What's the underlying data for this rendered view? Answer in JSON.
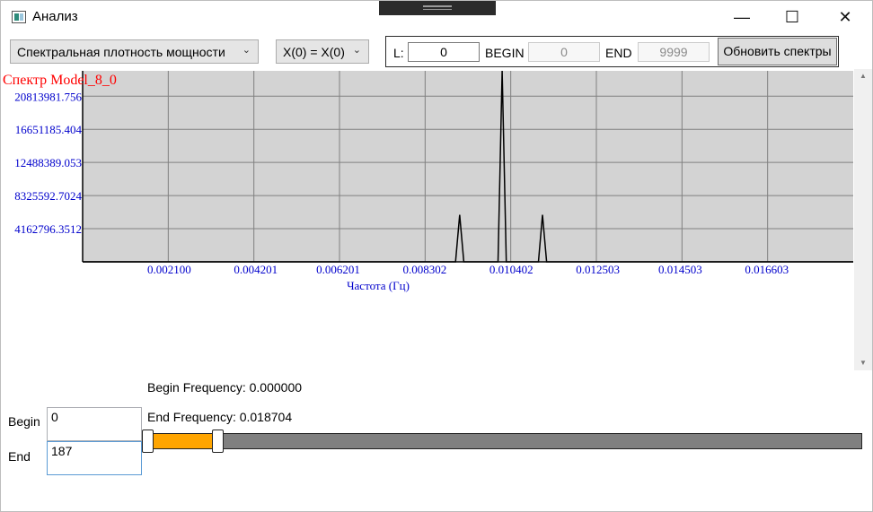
{
  "window": {
    "title": "Анализ",
    "controls": {
      "minimize": "—",
      "maximize": "☐",
      "close": "✕"
    }
  },
  "toolbar": {
    "spectrum_type": "Спектральная плотность мощности",
    "x0_mode": "X(0) = X(0)",
    "l_label": "L:",
    "l_value": "0",
    "begin_label": "BEGIN",
    "begin_value": "0",
    "end_label": "END",
    "end_value": "9999",
    "refresh_label": "Обновить спектры"
  },
  "chart_data": {
    "type": "line",
    "title": "Спектр Model_8_0",
    "xlabel": "Частота (Гц)",
    "ylabel": "",
    "x_ticks": [
      "0.002100",
      "0.004201",
      "0.006201",
      "0.008302",
      "0.010402",
      "0.012503",
      "0.014503",
      "0.016603"
    ],
    "y_ticks": [
      "20813981.756",
      "16651185.404",
      "12488389.053",
      "8325592.7024",
      "4162796.3512"
    ],
    "xlim": [
      0.0,
      0.0187
    ],
    "ylim": [
      0,
      24000000
    ],
    "grid": true,
    "series": [
      {
        "x": [
          0.0,
          0.00905,
          0.00915,
          0.00925,
          0.01008,
          0.01018,
          0.01028,
          0.01106,
          0.01116,
          0.01126,
          0.0187
        ],
        "y": [
          0,
          0,
          5900000,
          0,
          0,
          24000000,
          0,
          0,
          5900000,
          0,
          0
        ]
      }
    ],
    "colors": {
      "title": "#ff0000",
      "ticks": "#0000cc",
      "plot_bg": "#d3d3d3",
      "grid": "#808080",
      "line": "#000000"
    }
  },
  "range": {
    "begin_frequency": "Begin Frequency: 0.000000",
    "end_frequency": "End Frequency: 0.018704",
    "begin_label": "Begin",
    "end_label": "End",
    "begin_value": "0",
    "end_value": "187",
    "slider": {
      "min": 0,
      "max": 9999,
      "low": 0,
      "high": 187
    },
    "colors": {
      "track": "#808080",
      "selection": "#ffa500"
    }
  }
}
